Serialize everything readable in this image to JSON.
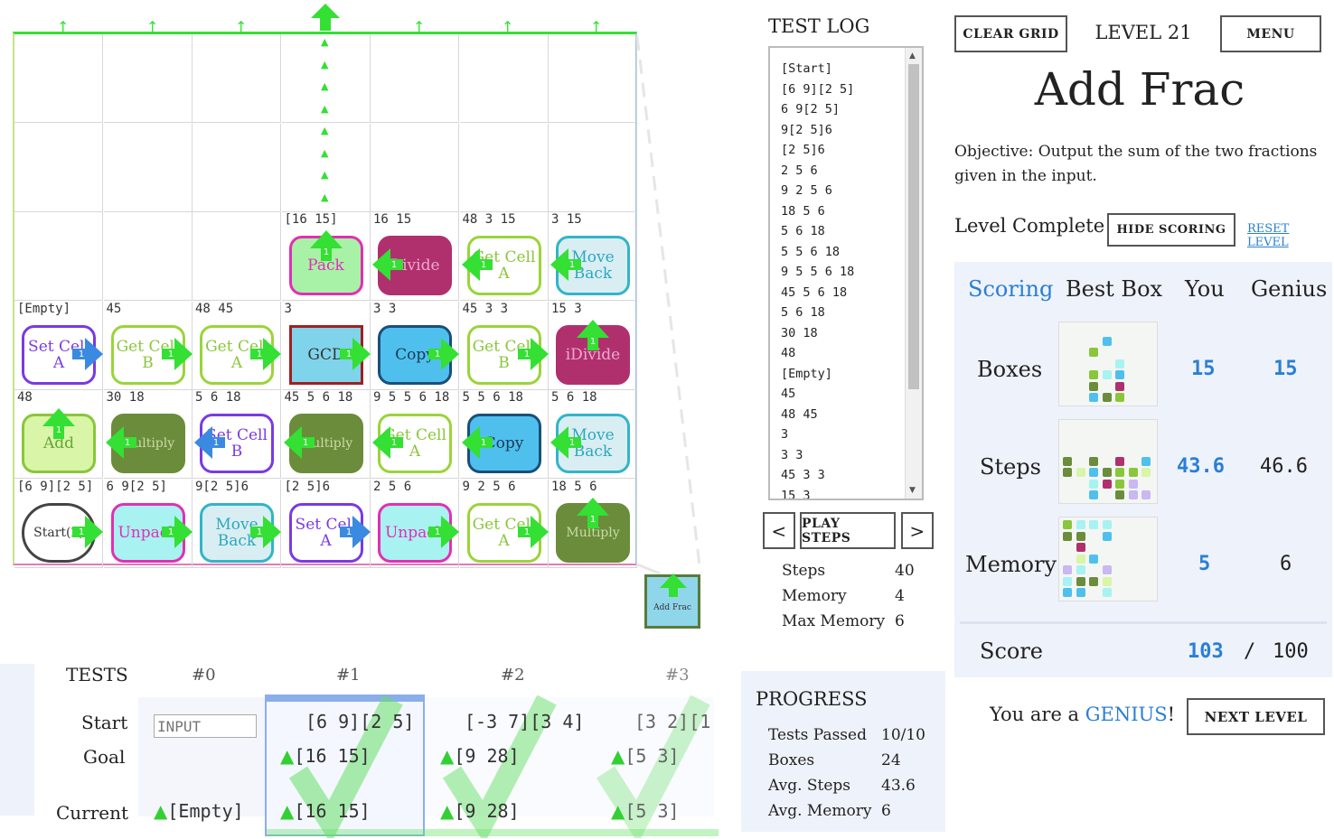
{
  "grid": {
    "cells": [
      {
        "r": 2,
        "c": 3,
        "val": "[16 15]",
        "tile": "Pack",
        "style": "t-pink"
      },
      {
        "r": 2,
        "c": 4,
        "val": "16 15",
        "tile": "Divide",
        "style": "t-mag"
      },
      {
        "r": 2,
        "c": 5,
        "val": "48 3 15",
        "tile": "Get Cell A",
        "style": "t-lime"
      },
      {
        "r": 2,
        "c": 6,
        "val": "3 15",
        "tile": "Move Back",
        "style": "t-teal"
      },
      {
        "r": 3,
        "c": 0,
        "val": "[Empty]",
        "tile": "Set Cell A",
        "style": "t-purple"
      },
      {
        "r": 3,
        "c": 1,
        "val": "45",
        "tile": "Get Cell B",
        "style": "t-lime"
      },
      {
        "r": 3,
        "c": 2,
        "val": "48 45",
        "tile": "Get Cell A",
        "style": "t-lime"
      },
      {
        "r": 3,
        "c": 3,
        "val": "3",
        "tile": "GCD",
        "style": "t-gcd"
      },
      {
        "r": 3,
        "c": 4,
        "val": "3 3",
        "tile": "Copy",
        "style": "t-blue"
      },
      {
        "r": 3,
        "c": 5,
        "val": "45 3 3",
        "tile": "Get Cell B",
        "style": "t-lime"
      },
      {
        "r": 3,
        "c": 6,
        "val": "15 3",
        "tile": "iDivide",
        "style": "t-mag"
      },
      {
        "r": 4,
        "c": 0,
        "val": "48",
        "tile": "Add",
        "style": "t-addl"
      },
      {
        "r": 4,
        "c": 1,
        "val": "30 18",
        "tile": "Multiply",
        "style": "t-olive"
      },
      {
        "r": 4,
        "c": 2,
        "val": "5 6 18",
        "tile": "Set Cell B",
        "style": "t-purple"
      },
      {
        "r": 4,
        "c": 3,
        "val": "45 5 6 18",
        "tile": "Multiply",
        "style": "t-olive"
      },
      {
        "r": 4,
        "c": 4,
        "val": "9 5 5 6 18",
        "tile": "Get Cell A",
        "style": "t-lime"
      },
      {
        "r": 4,
        "c": 5,
        "val": "5 5 6 18",
        "tile": "Copy",
        "style": "t-blue"
      },
      {
        "r": 4,
        "c": 6,
        "val": "5 6 18",
        "tile": "Move Back",
        "style": "t-teal"
      },
      {
        "r": 5,
        "c": 0,
        "val": "[6 9][2 5]",
        "tile": "Start(2)",
        "style": "t-start"
      },
      {
        "r": 5,
        "c": 1,
        "val": "6 9[2 5]",
        "tile": "Unpack",
        "style": "t-magenta"
      },
      {
        "r": 5,
        "c": 2,
        "val": "9[2 5]6",
        "tile": "Move Back",
        "style": "t-teal"
      },
      {
        "r": 5,
        "c": 3,
        "val": "[2 5]6",
        "tile": "Set Cell A",
        "style": "t-purple"
      },
      {
        "r": 5,
        "c": 4,
        "val": "2 5 6",
        "tile": "Unpack",
        "style": "t-magenta"
      },
      {
        "r": 5,
        "c": 5,
        "val": "9 2 5 6",
        "tile": "Get Cell A",
        "style": "t-lime"
      },
      {
        "r": 5,
        "c": 6,
        "val": "18 5 6",
        "tile": "Multiply",
        "style": "t-olive"
      }
    ],
    "output_box_label": "Add Frac",
    "arrow_badge": "1"
  },
  "test_log": {
    "title": "TEST LOG",
    "lines": [
      "[Start]",
      "[6 9][2 5]",
      "6 9[2 5]",
      "9[2 5]6",
      "[2 5]6",
      "2 5 6",
      "9 2 5 6",
      "18 5 6",
      "5 6 18",
      "5 5 6 18",
      "9 5 5 6 18",
      "45 5 6 18",
      "5 6 18",
      "30 18",
      "48",
      "[Empty]",
      "45",
      "48 45",
      "3",
      "3 3",
      "45 3 3",
      "15 3"
    ],
    "prev_label": "<",
    "play_label": "PLAY STEPS",
    "next_label": ">",
    "stats": [
      {
        "label": "Steps",
        "value": "40"
      },
      {
        "label": "Memory",
        "value": "4"
      },
      {
        "label": "Max Memory",
        "value": "6"
      }
    ]
  },
  "header": {
    "clear_label": "CLEAR GRID",
    "level_label": "LEVEL 21",
    "menu_label": "MENU",
    "title": "Add Frac",
    "objective": "Objective: Output the sum of the two fractions given in the input.",
    "complete_label": "Level Complete!",
    "hide_scoring_label": "HIDE SCORING",
    "reset_label": "RESET LEVEL"
  },
  "scoring": {
    "headers": {
      "scoring": "Scoring",
      "best": "Best Box",
      "you": "You",
      "genius": "Genius"
    },
    "rows": [
      {
        "label": "Boxes",
        "you": "15",
        "genius": "15"
      },
      {
        "label": "Steps",
        "you": "43.6",
        "genius": "46.6"
      },
      {
        "label": "Memory",
        "you": "5",
        "genius": "6"
      }
    ],
    "score_label": "Score",
    "score_you": "103",
    "score_sep": "/",
    "score_total": "100",
    "genius_prefix": "You are a ",
    "genius_word": "GENIUS",
    "genius_suffix": "!",
    "next_label": "NEXT LEVEL",
    "accent": "#2a7fd4"
  },
  "tests": {
    "title": "TESTS",
    "row_labels": {
      "start": "Start",
      "goal": "Goal",
      "current": "Current"
    },
    "input_placeholder": "INPUT",
    "current0": "[Empty]",
    "columns": [
      {
        "id": "#0"
      },
      {
        "id": "#1",
        "start": "[6 9][2 5]",
        "goal": "[16 15]",
        "current": "[16 15]"
      },
      {
        "id": "#2",
        "start": "[-3 7][3 4]",
        "goal": "[9 28]",
        "current": "[9 28]"
      },
      {
        "id": "#3",
        "start": "[3 2][1",
        "goal": "[5 3]",
        "current": "[5 3]"
      }
    ]
  },
  "progress": {
    "title": "PROGRESS",
    "rows": [
      {
        "label": "Tests Passed",
        "value": "10/10"
      },
      {
        "label": "Boxes",
        "value": "24"
      },
      {
        "label": "Avg. Steps",
        "value": "43.6"
      },
      {
        "label": "Avg. Memory",
        "value": "6"
      }
    ]
  }
}
